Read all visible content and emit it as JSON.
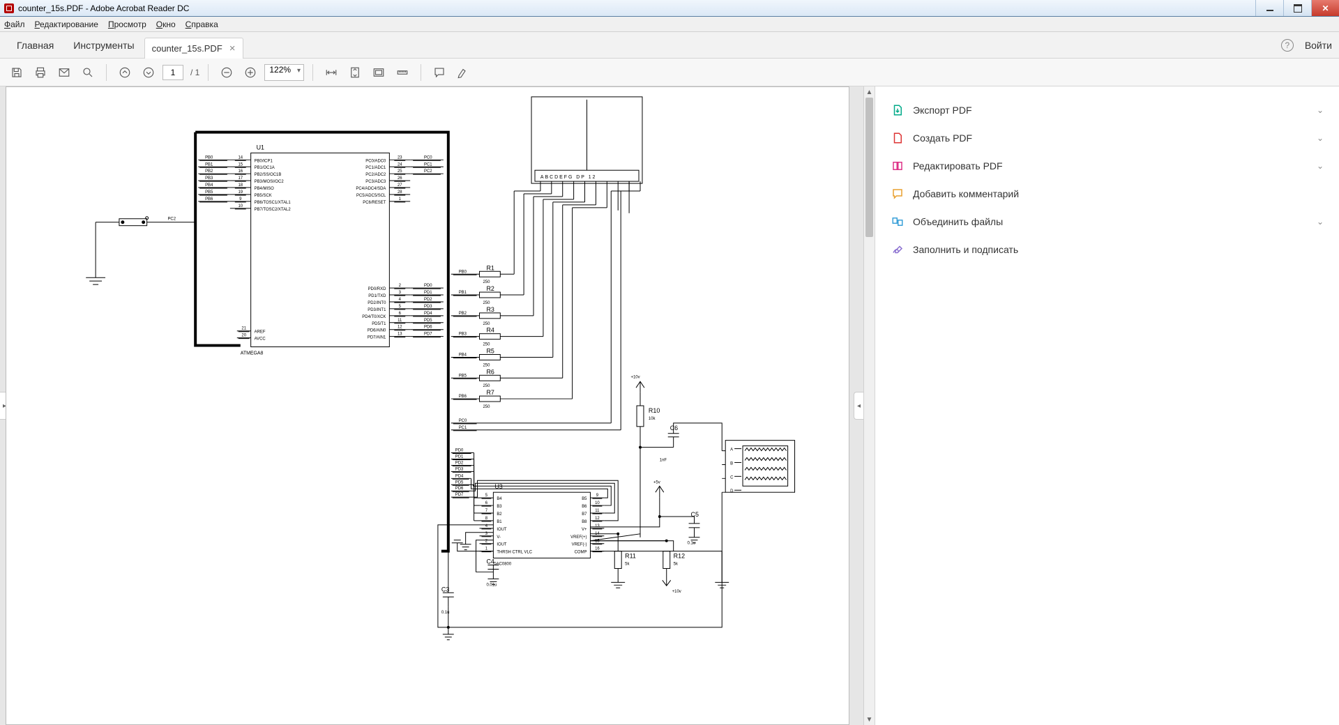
{
  "window": {
    "title": "counter_15s.PDF - Adobe Acrobat Reader DC"
  },
  "menu": {
    "file": "Файл",
    "edit": "Редактирование",
    "view": "Просмотр",
    "window": "Окно",
    "help": "Справка"
  },
  "tabs": {
    "home": "Главная",
    "tools": "Инструменты",
    "file": "counter_15s.PDF",
    "login": "Войти"
  },
  "toolbar": {
    "page_current": "1",
    "page_total": "/ 1",
    "zoom": "122%"
  },
  "rightpanel": {
    "export": "Экспорт PDF",
    "create": "Создать PDF",
    "edit": "Редактировать PDF",
    "comment": "Добавить комментарий",
    "combine": "Объединить файлы",
    "sign": "Заполнить и подписать"
  },
  "schematic": {
    "u1": {
      "ref": "U1",
      "part": "ATMEGA8",
      "left_pins": [
        {
          "num": "14",
          "name": "PB0/ICP1"
        },
        {
          "num": "15",
          "name": "PB1/OC1A"
        },
        {
          "num": "16",
          "name": "PB2/SS/OC1B"
        },
        {
          "num": "17",
          "name": "PB3/MOSI/OC2"
        },
        {
          "num": "18",
          "name": "PB4/MISO"
        },
        {
          "num": "19",
          "name": "PB5/SCK"
        },
        {
          "num": "9",
          "name": "PB6/TOSC1/XTAL1"
        },
        {
          "num": "10",
          "name": "PB7/TOSC2/XTAL2"
        }
      ],
      "left_pins2": [
        {
          "num": "21",
          "name": "AREF"
        },
        {
          "num": "20",
          "name": "AVCC"
        }
      ],
      "right_pins_pc": [
        {
          "num": "23",
          "name": "PC0/ADC0"
        },
        {
          "num": "24",
          "name": "PC1/ADC1"
        },
        {
          "num": "25",
          "name": "PC2/ADC2"
        },
        {
          "num": "26",
          "name": "PC3/ADC3"
        },
        {
          "num": "27",
          "name": "PC4/ADC4/SDA"
        },
        {
          "num": "28",
          "name": "PC5/ADC5/SCL"
        },
        {
          "num": "1",
          "name": "PC6/RESET"
        }
      ],
      "right_pins_pd": [
        {
          "num": "2",
          "name": "PD0/RXD"
        },
        {
          "num": "3",
          "name": "PD1/TXD"
        },
        {
          "num": "4",
          "name": "PD2/INT0"
        },
        {
          "num": "5",
          "name": "PD3/INT1"
        },
        {
          "num": "6",
          "name": "PD4/T0/XCK"
        },
        {
          "num": "11",
          "name": "PD5/T1"
        },
        {
          "num": "12",
          "name": "PD6/AIN0"
        },
        {
          "num": "13",
          "name": "PD7/AIN1"
        }
      ],
      "left_nets": [
        "PB0",
        "PB1",
        "PB2",
        "PB3",
        "PB4",
        "PB5",
        "PB6",
        ""
      ],
      "right_nets_pc": [
        "PC0",
        "PC1",
        "PC2",
        "",
        "",
        "",
        ""
      ],
      "right_nets_pd": [
        "PD0",
        "PD1",
        "PD2",
        "PD3",
        "PD4",
        "PD5",
        "PD6",
        "PD7"
      ],
      "pc2_label": "PC2"
    },
    "display": {
      "pins_label": "ABCDEFG DP  12"
    },
    "resistors": [
      {
        "ref": "R1",
        "val": "250",
        "net": "PB0"
      },
      {
        "ref": "R2",
        "val": "250",
        "net": "PB1"
      },
      {
        "ref": "R3",
        "val": "250",
        "net": "PB2"
      },
      {
        "ref": "R4",
        "val": "250",
        "net": "PB3"
      },
      {
        "ref": "R5",
        "val": "250",
        "net": "PB4"
      },
      {
        "ref": "R6",
        "val": "250",
        "net": "PB5"
      },
      {
        "ref": "R7",
        "val": "250",
        "net": "PB6"
      }
    ],
    "pc_nets": [
      "PC0",
      "PC1"
    ],
    "r10": {
      "ref": "R10",
      "val": "10k"
    },
    "r11": {
      "ref": "R11",
      "val": "5k"
    },
    "r12": {
      "ref": "R12",
      "val": "5k"
    },
    "c3": {
      "ref": "C3",
      "val": "0.1u"
    },
    "c4": {
      "ref": "C4",
      "val": "0.01u"
    },
    "c5": {
      "ref": "C5",
      "val": "0.1u"
    },
    "c6": {
      "ref": "C6",
      "val": "1nF"
    },
    "v10": "+10v",
    "v5": "+5v",
    "v10b": "+10v",
    "u3": {
      "ref": "U3",
      "part": "DAC0800",
      "left_pins": [
        {
          "num": "5",
          "name": "B4"
        },
        {
          "num": "6",
          "name": "B3"
        },
        {
          "num": "7",
          "name": "B2"
        },
        {
          "num": "8",
          "name": "B1"
        },
        {
          "num": "4",
          "name": "IOUT"
        },
        {
          "num": "3",
          "name": "V-"
        },
        {
          "num": "2",
          "name": "IOUT"
        },
        {
          "num": "1",
          "name": "THRSH CTRL VLC"
        }
      ],
      "right_pins": [
        {
          "num": "9",
          "name": "B5"
        },
        {
          "num": "10",
          "name": "B6"
        },
        {
          "num": "11",
          "name": "B7"
        },
        {
          "num": "12",
          "name": "B8"
        },
        {
          "num": "13",
          "name": "V+"
        },
        {
          "num": "14",
          "name": "VREF(+)"
        },
        {
          "num": "15",
          "name": "VREF(-)"
        },
        {
          "num": "16",
          "name": "COMP"
        }
      ],
      "left_nets": [
        "PD0",
        "PD1",
        "PD2",
        "PD3"
      ],
      "right_route_nets": [
        "PD4",
        "PD5",
        "PD6",
        "PD7"
      ]
    },
    "scope": {
      "labels": [
        "A",
        "B",
        "C",
        "D"
      ]
    }
  }
}
